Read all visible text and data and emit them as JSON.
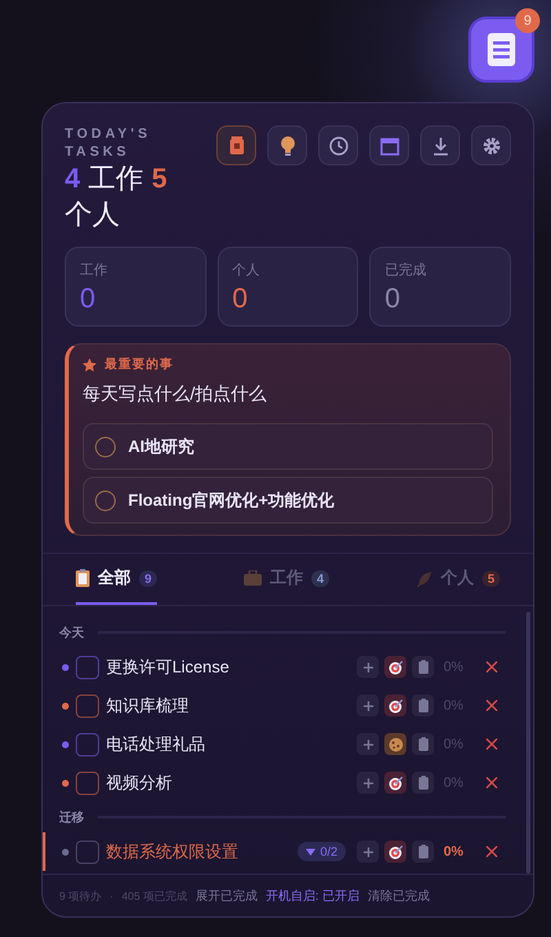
{
  "fab": {
    "badge": "9"
  },
  "header": {
    "title": "TODAY'S TASKS",
    "work_count": "4",
    "work_label": "工作",
    "personal_count": "5",
    "personal_label": "个人"
  },
  "toolbar": [
    {
      "kind": "cup",
      "selected": true
    },
    {
      "kind": "bulb",
      "selected": false
    },
    {
      "kind": "clock",
      "selected": false
    },
    {
      "kind": "calendar",
      "selected": false
    },
    {
      "kind": "download",
      "selected": false
    },
    {
      "kind": "gear",
      "selected": false
    }
  ],
  "stats": [
    {
      "label": "工作",
      "value": "0",
      "color": "#7c5cf0"
    },
    {
      "label": "个人",
      "value": "0",
      "color": "#e0694a"
    },
    {
      "label": "已完成",
      "value": "0",
      "color": "#8a86a8"
    }
  ],
  "important": {
    "label": "最重要的事",
    "text": "每天写点什么/拍点什么",
    "items": [
      {
        "text": "AI地研究",
        "checked": false
      },
      {
        "text": "Floating官网优化+功能优化",
        "checked": false
      }
    ]
  },
  "tabs": [
    {
      "kind": "all",
      "label": "全部",
      "count": "9",
      "selected": true
    },
    {
      "kind": "work",
      "label": "工作",
      "count": "4",
      "selected": false
    },
    {
      "kind": "personal",
      "label": "个人",
      "count": "5",
      "selected": false
    }
  ],
  "sections": [
    {
      "title": "今天",
      "tasks": [
        {
          "text": "更换许可License",
          "color": "#7c5cf0",
          "kind": "target",
          "progress": "0%",
          "overdue": false,
          "checked": false
        },
        {
          "text": "知识库梳理",
          "color": "#e0694a",
          "kind": "target",
          "progress": "0%",
          "overdue": false,
          "checked": false
        },
        {
          "text": "电话处理礼品",
          "color": "#7c5cf0",
          "kind": "cookie",
          "progress": "0%",
          "overdue": false,
          "checked": false
        },
        {
          "text": "视频分析",
          "color": "#e0694a",
          "kind": "target",
          "progress": "0%",
          "overdue": false,
          "checked": false
        }
      ]
    },
    {
      "title": "迁移",
      "tasks": [
        {
          "text": "数据系统权限设置",
          "color": "#6b6a90",
          "kind": "target",
          "progress": "0%",
          "overdue": true,
          "checked": false,
          "subtasks": "0/2"
        }
      ]
    }
  ],
  "footer": {
    "pending": "9 项待办",
    "separator": "·",
    "done": "405 项已完成",
    "actions": [
      {
        "kind": "plain",
        "label": "展开已完成"
      },
      {
        "kind": "accent",
        "label": "开机自启: 已开启"
      },
      {
        "kind": "plain",
        "label": "清除已完成"
      }
    ]
  }
}
